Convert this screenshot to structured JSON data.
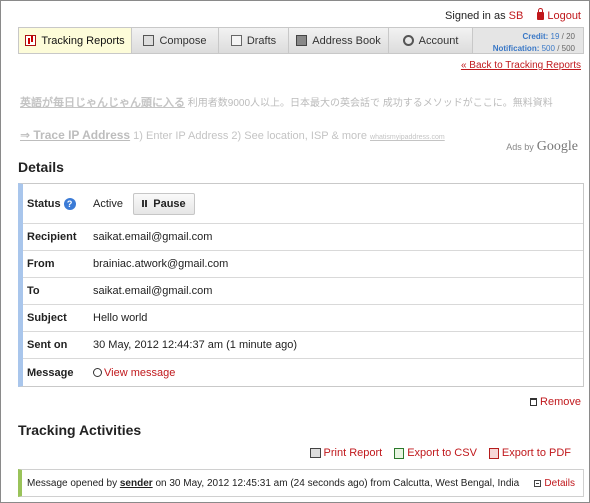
{
  "topbar": {
    "signed_in_prefix": "Signed in as",
    "user": "SB",
    "logout": "Logout"
  },
  "nav": {
    "tabs": [
      {
        "label": "Tracking Reports",
        "icon": "chart-icon",
        "active": true
      },
      {
        "label": "Compose",
        "icon": "compose-icon",
        "active": false
      },
      {
        "label": "Drafts",
        "icon": "drafts-icon",
        "active": false
      },
      {
        "label": "Address Book",
        "icon": "address-book-icon",
        "active": false
      },
      {
        "label": "Account",
        "icon": "gear-icon",
        "active": false
      }
    ],
    "credit_label": "Credit:",
    "credit_used": "19",
    "credit_total": "/ 20",
    "notification_label": "Notification:",
    "notification_used": "500",
    "notification_total": "/ 500"
  },
  "back_link": "« Back to Tracking Reports",
  "ads": {
    "ad1_title": "英語が毎日じゃんじゃん頭に入る",
    "ad1_text": "利用者数9000人以上。日本最大の英会話で 成功するメソッドがここに。無料資料",
    "ad2_title": "⇒ Trace IP Address",
    "ad2_text": "1) Enter IP Address 2) See location, ISP & more",
    "ad2_url": "whatismyipaddress.com",
    "ads_by": "Ads by",
    "google": "Google"
  },
  "details": {
    "title": "Details",
    "status_label": "Status",
    "status_value": "Active",
    "pause_label": "Pause",
    "recipient_label": "Recipient",
    "recipient_value": "saikat.email@gmail.com",
    "from_label": "From",
    "from_value": "brainiac.atwork@gmail.com",
    "to_label": "To",
    "to_value": "saikat.email@gmail.com",
    "subject_label": "Subject",
    "subject_value": "Hello world",
    "sent_label": "Sent on",
    "sent_value": "30 May, 2012 12:44:37 am (1 minute ago)",
    "message_label": "Message",
    "message_link": "View message"
  },
  "remove_label": "Remove",
  "activities": {
    "title": "Tracking Activities",
    "print": "Print Report",
    "csv": "Export to CSV",
    "pdf": "Export to PDF",
    "item_prefix": "Message opened by",
    "item_sender": "sender",
    "item_suffix": "on 30 May, 2012 12:45:31 am (24 seconds ago) from Calcutta, West Bengal, India",
    "details_link": "Details"
  },
  "colors": {
    "accent_red": "#c0181c",
    "details_border": "#a9c6ec",
    "activity_border": "#9ac35a",
    "credit_blue": "#3a78c6"
  }
}
